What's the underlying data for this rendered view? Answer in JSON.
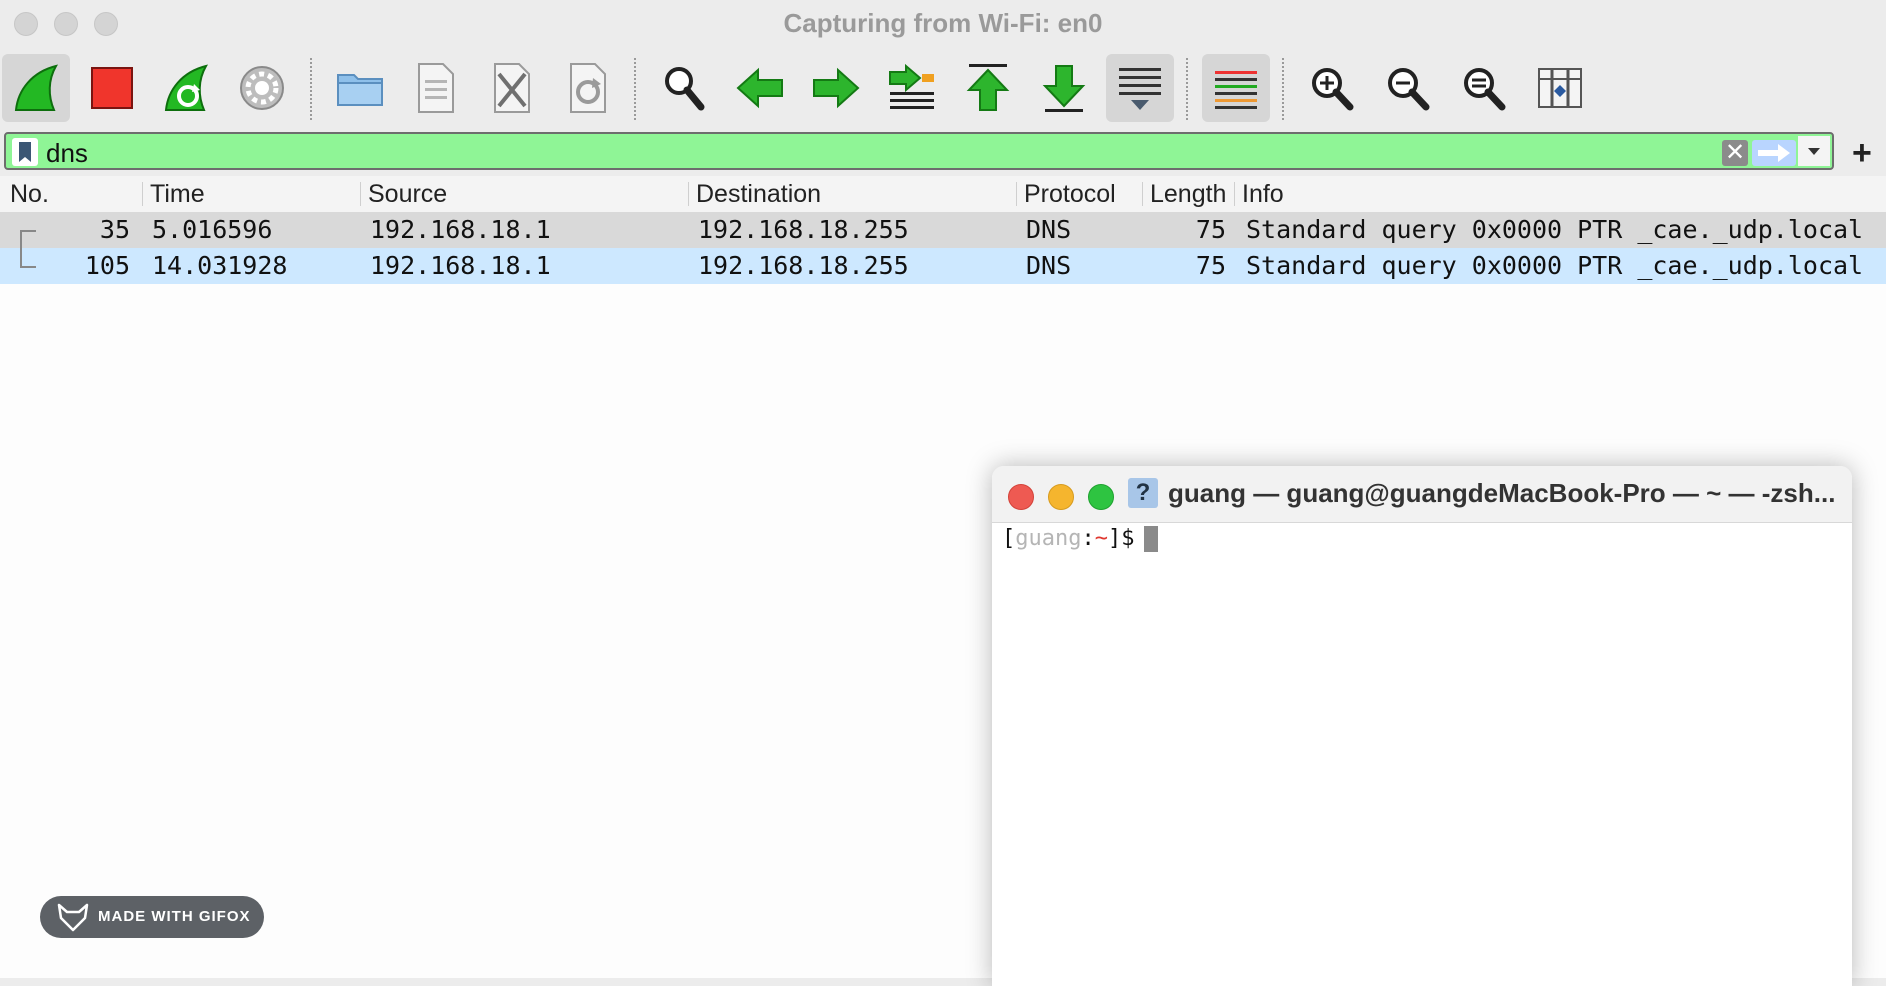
{
  "window": {
    "title": "Capturing from Wi-Fi: en0"
  },
  "toolbar": {
    "buttons": [
      {
        "name": "start-capture",
        "icon": "shark-fin-icon"
      },
      {
        "name": "stop-capture",
        "icon": "stop-square-icon"
      },
      {
        "name": "restart-capture",
        "icon": "restart-fin-icon"
      },
      {
        "name": "capture-options",
        "icon": "gear-icon"
      },
      {
        "name": "open-file",
        "icon": "folder-icon"
      },
      {
        "name": "save-file",
        "icon": "file-binary-icon"
      },
      {
        "name": "close-file",
        "icon": "file-close-icon"
      },
      {
        "name": "reload-file",
        "icon": "file-reload-icon"
      },
      {
        "name": "find-packet",
        "icon": "magnifier-icon"
      },
      {
        "name": "go-back",
        "icon": "arrow-left-icon"
      },
      {
        "name": "go-forward",
        "icon": "arrow-right-icon"
      },
      {
        "name": "go-to-packet",
        "icon": "goto-packet-icon"
      },
      {
        "name": "go-first",
        "icon": "arrow-up-icon"
      },
      {
        "name": "go-last",
        "icon": "arrow-down-icon"
      },
      {
        "name": "auto-scroll",
        "icon": "autoscroll-icon"
      },
      {
        "name": "colorize",
        "icon": "colorize-lines-icon"
      },
      {
        "name": "zoom-in",
        "icon": "zoom-in-icon"
      },
      {
        "name": "zoom-out",
        "icon": "zoom-out-icon"
      },
      {
        "name": "normal-size",
        "icon": "zoom-reset-icon"
      },
      {
        "name": "resize-columns",
        "icon": "resize-columns-icon"
      }
    ]
  },
  "filter": {
    "value": "dns",
    "clear_glyph": "✕"
  },
  "table": {
    "columns": [
      "No.",
      "Time",
      "Source",
      "Destination",
      "Protocol",
      "Length",
      "Info"
    ],
    "rows": [
      {
        "no": "35",
        "time": "5.016596",
        "source": "192.168.18.1",
        "destination": "192.168.18.255",
        "protocol": "DNS",
        "length": "75",
        "info": "Standard query 0x0000 PTR _cae._udp.local"
      },
      {
        "no": "105",
        "time": "14.031928",
        "source": "192.168.18.1",
        "destination": "192.168.18.255",
        "protocol": "DNS",
        "length": "75",
        "info": "Standard query 0x0000 PTR _cae._udp.local"
      }
    ]
  },
  "terminal": {
    "title": "guang — guang@guangdeMacBook-Pro — ~ — -zsh...",
    "icon_glyph": "?",
    "prompt_open": "[",
    "prompt_user": "guang",
    "prompt_colon": ":",
    "prompt_dir": "~",
    "prompt_close": "]$"
  },
  "watermark": {
    "label": "MADE WITH GIFOX"
  },
  "colors": {
    "filter_valid": "#8ff596",
    "selected_row": "#cde8ff",
    "stop_red": "#f0352c",
    "arrow_green": "#2db52d"
  }
}
